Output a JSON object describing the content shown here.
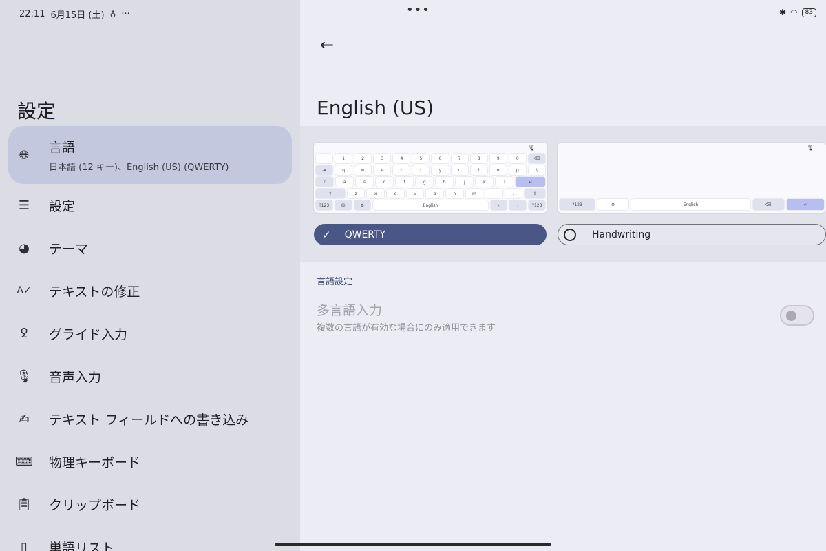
{
  "status": {
    "time": "22:11",
    "date": "6月15日 (土)",
    "extra_icon": "pin-icon",
    "more": "···",
    "battery": "83"
  },
  "sidebar": {
    "title": "設定",
    "items": [
      {
        "label": "言語",
        "sublabel": "日本語 (12 キー)、English (US) (QWERTY)",
        "icon": "globe-icon",
        "glyph": "🌐︎",
        "selected": true
      },
      {
        "label": "設定",
        "icon": "sliders-icon",
        "glyph": "☰"
      },
      {
        "label": "テーマ",
        "icon": "palette-icon",
        "glyph": "◕"
      },
      {
        "label": "テキストの修正",
        "icon": "spellcheck-icon",
        "glyph": "A✓"
      },
      {
        "label": "グライド入力",
        "icon": "gesture-icon",
        "glyph": "ꝿ"
      },
      {
        "label": "音声入力",
        "icon": "mic-icon",
        "glyph": "🎙︎"
      },
      {
        "label": "テキスト フィールドへの書き込み",
        "icon": "pen-icon",
        "glyph": "✍︎"
      },
      {
        "label": "物理キーボード",
        "icon": "keyboard-icon",
        "glyph": "⌨︎"
      },
      {
        "label": "クリップボード",
        "icon": "clipboard-icon",
        "glyph": "📋︎"
      },
      {
        "label": "単語リスト",
        "icon": "book-icon",
        "glyph": "▯"
      }
    ]
  },
  "header": {
    "back_glyph": "←",
    "title": "English (US)"
  },
  "keyboards": {
    "qwerty_rows": [
      [
        "`",
        "1",
        "2",
        "3",
        "4",
        "5",
        "6",
        "7",
        "8",
        "9",
        "0",
        "⌫"
      ],
      [
        "⇥",
        "q",
        "w",
        "e",
        "r",
        "t",
        "y",
        "u",
        "i",
        "o",
        "p",
        "\\"
      ],
      [
        "a",
        "s",
        "d",
        "f",
        "g",
        "h",
        "j",
        "k",
        "l",
        "↵"
      ],
      [
        "⇧",
        "z",
        "x",
        "c",
        "v",
        "b",
        "n",
        "m",
        ",",
        ".",
        "⇧"
      ],
      [
        "?123",
        "☺",
        "⚙",
        "English",
        "‹",
        "›",
        "?123"
      ]
    ],
    "handwriting_bar": [
      "?123",
      "⚙",
      "English",
      "⌫",
      "↵"
    ],
    "mic": "🎙︎"
  },
  "layouts": {
    "qwerty": {
      "label": "QWERTY",
      "selected": true,
      "check": "✓"
    },
    "handwriting": {
      "label": "Handwriting",
      "selected": false
    }
  },
  "language_settings": {
    "section_title": "言語設定",
    "multi_lang_title": "多言語入力",
    "multi_lang_sub": "複数の言語が有効な場合にのみ適用できます",
    "multi_lang_enabled": false
  },
  "colors": {
    "accent": "#4a5786",
    "selected_nav": "#c3c8de",
    "left_bg": "#dcdce4",
    "right_bg": "#ececf4"
  }
}
